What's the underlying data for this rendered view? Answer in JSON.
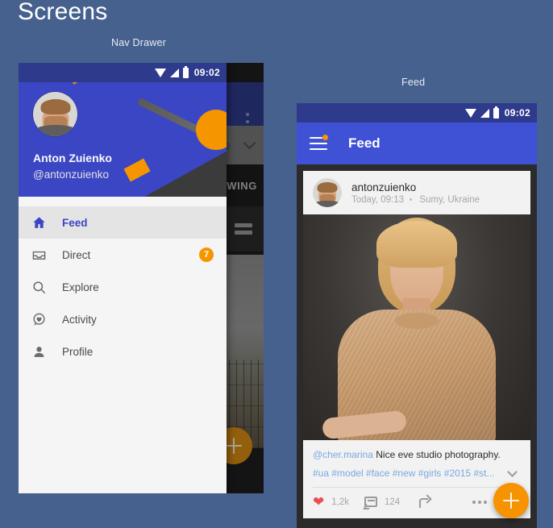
{
  "page": {
    "title": "Screens",
    "bg_color": "#47618f"
  },
  "colors": {
    "accent_indigo": "#3f51d5",
    "statusbar_indigo": "#2e3a8c",
    "accent_orange": "#f59500",
    "fab_orange": "#f79300",
    "heart_red": "#e8504f",
    "link_blue": "#7aa8e0"
  },
  "panels": [
    {
      "caption": "Nav Drawer"
    },
    {
      "caption": "Feed"
    }
  ],
  "nav_drawer": {
    "statusbar": {
      "time": "09:02",
      "wifi_icon": "wifi-icon",
      "signal_icon": "signal-icon",
      "battery_icon": "battery-icon"
    },
    "header": {
      "avatar": "user-avatar",
      "name": "Anton Zuienko",
      "handle": "@antonzuienko"
    },
    "items": [
      {
        "label": "Feed",
        "icon": "home-icon",
        "selected": true,
        "badge": ""
      },
      {
        "label": "Direct",
        "icon": "inbox-icon",
        "selected": false,
        "badge": "7"
      },
      {
        "label": "Explore",
        "icon": "search-icon",
        "selected": false,
        "badge": ""
      },
      {
        "label": "Activity",
        "icon": "activity-icon",
        "selected": false,
        "badge": ""
      },
      {
        "label": "Profile",
        "icon": "person-icon",
        "selected": false,
        "badge": ""
      }
    ],
    "background_screen": {
      "overflow_icon": "overflow-menu-icon",
      "tab_label": "e",
      "chevron_icon": "chevron-down-icon",
      "following_label": "WING",
      "grid_icon": "grid-view-icon",
      "fab_icon": "add-icon"
    }
  },
  "feed": {
    "statusbar": {
      "time": "09:02",
      "wifi_icon": "wifi-icon",
      "signal_icon": "signal-icon",
      "battery_icon": "battery-icon"
    },
    "appbar": {
      "menu_icon": "hamburger-menu-icon",
      "title": "Feed",
      "badge_dot": "notification-dot"
    },
    "post": {
      "avatar": "post-author-avatar",
      "username": "antonzuienko",
      "timestamp": "Today, 09:13",
      "location": "Sumy, Ukraine",
      "photo": "portrait-photo",
      "caption_user": "@cher.marina",
      "caption_text": "Nice eve studio photography.",
      "tags": "#ua #model #face #new #girls #2015 #st...",
      "expand_icon": "chevron-down-icon",
      "likes": "1,2k",
      "comments": "124",
      "like_icon": "heart-icon",
      "comment_icon": "comment-icon",
      "share_icon": "share-icon",
      "more_icon": "more-options-icon"
    },
    "fab": {
      "icon": "add-icon"
    }
  }
}
